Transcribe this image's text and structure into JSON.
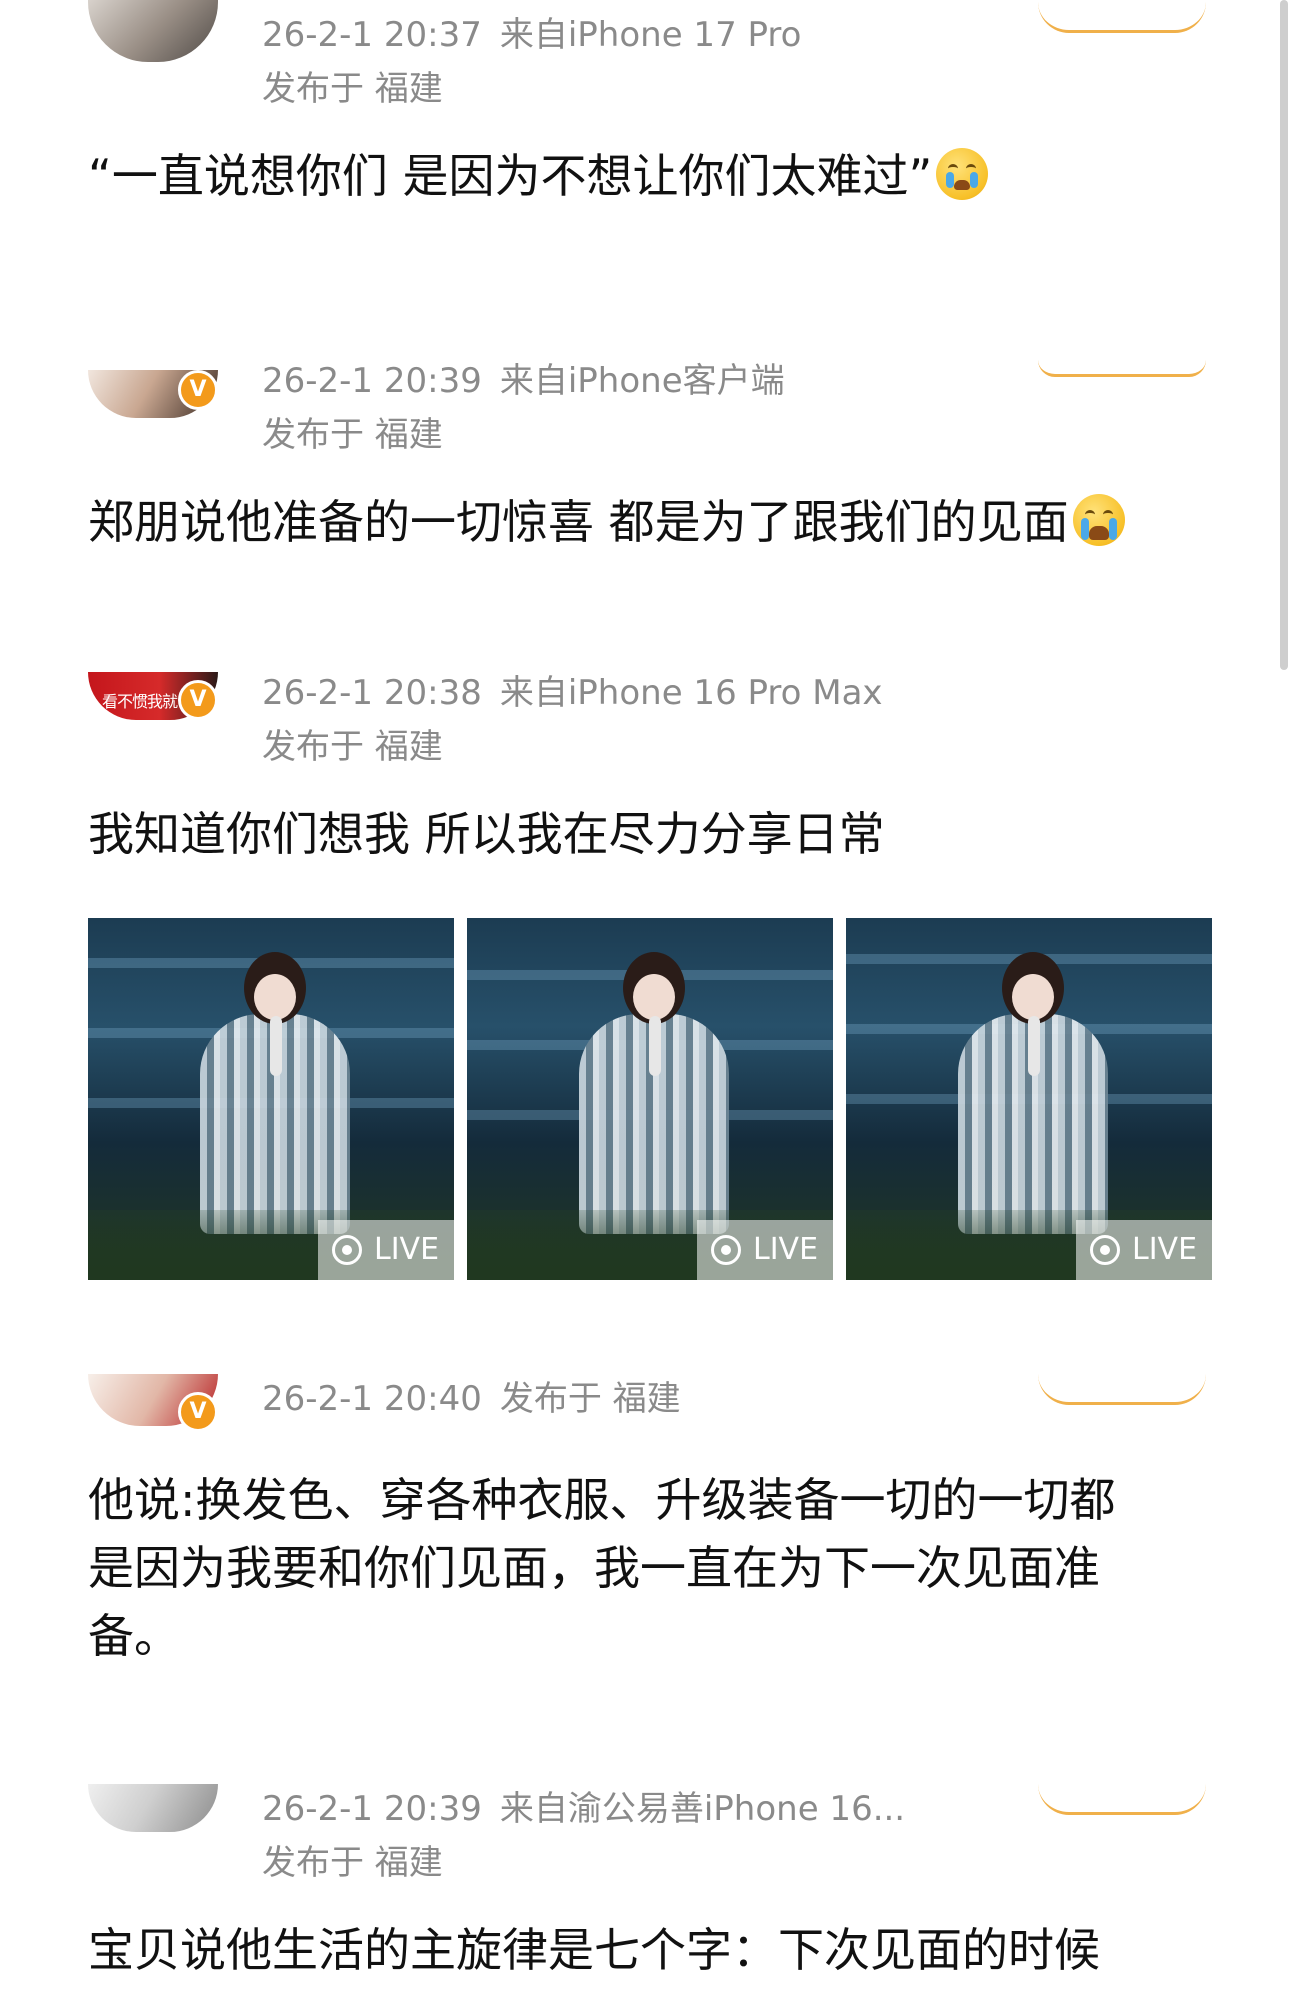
{
  "posts": [
    {
      "time": "26-2-1 20:37",
      "source": "来自iPhone 17 Pro",
      "location": "发布于 福建",
      "text": "“一直说想你们 是因为不想让你们太难过”",
      "emoji": "crying-face"
    },
    {
      "time": "26-2-1 20:39",
      "source": "来自iPhone客户端",
      "location": "发布于 福建",
      "verified": "V",
      "text": "郑朋说他准备的一切惊喜 都是为了跟我们的见面",
      "emoji": "loudly-crying-face"
    },
    {
      "time": "26-2-1 20:38",
      "source": "来自iPhone 16 Pro Max",
      "location": "发布于 福建",
      "verified": "V",
      "avatar_text": "看不惯我就",
      "text": "我知道你们想我 所以我在尽力分享日常",
      "photos": [
        {
          "badge": "LIVE"
        },
        {
          "badge": "LIVE"
        },
        {
          "badge": "LIVE"
        }
      ]
    },
    {
      "time": "26-2-1 20:40",
      "location": "发布于 福建",
      "verified": "V",
      "text_lines": [
        "他说:换发色、穿各种衣服、升级装备一切的一切都",
        "是因为我要和你们见面，我一直在为下一次见面准",
        "备。"
      ]
    },
    {
      "time": "26-2-1 20:39",
      "source": "来自渝公易善iPhone 16...",
      "location": "发布于 福建",
      "text": "宝贝说他生活的主旋律是七个字：下次见面的时候"
    }
  ]
}
